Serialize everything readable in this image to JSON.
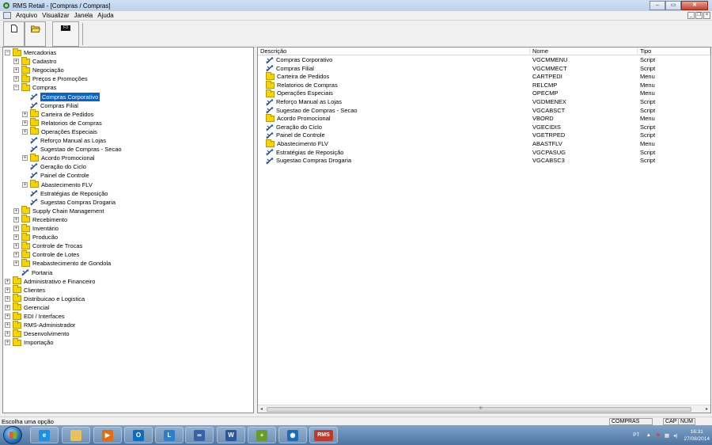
{
  "window": {
    "title": "RMS Retail - [Compras / Compras]",
    "buttons": [
      "",
      "",
      ""
    ]
  },
  "menubar": {
    "items": [
      "Arquivo",
      "Visualizar",
      "Janela",
      "Ajuda"
    ]
  },
  "toolbar": {
    "buttons": [
      {
        "icon": "new-document-icon"
      },
      {
        "icon": "open-folder-icon"
      },
      {
        "icon": "f3-key-icon",
        "label": "F3"
      }
    ]
  },
  "tree": {
    "items": [
      {
        "label": "Mercadorias",
        "level": 0,
        "expander": "-",
        "icon": "folder"
      },
      {
        "label": "Cadastro",
        "level": 1,
        "expander": "+",
        "icon": "folder"
      },
      {
        "label": "Negociação",
        "level": 1,
        "expander": "+",
        "icon": "folder"
      },
      {
        "label": "Preços e Promoções",
        "level": 1,
        "expander": "+",
        "icon": "folder"
      },
      {
        "label": "Compras",
        "level": 1,
        "expander": "-",
        "icon": "folder"
      },
      {
        "label": "Compras Corporativo",
        "level": 2,
        "expander": "",
        "icon": "script",
        "selected": true
      },
      {
        "label": "Compras Filial",
        "level": 2,
        "expander": "",
        "icon": "script"
      },
      {
        "label": "Carteira de Pedidos",
        "level": 2,
        "expander": "+",
        "icon": "folder"
      },
      {
        "label": "Relatorios de Compras",
        "level": 2,
        "expander": "+",
        "icon": "folder"
      },
      {
        "label": "Operações Especiais",
        "level": 2,
        "expander": "+",
        "icon": "folder"
      },
      {
        "label": "Reforço Manual as Lojas",
        "level": 2,
        "expander": "",
        "icon": "script"
      },
      {
        "label": "Sugestao de Compras - Secao",
        "level": 2,
        "expander": "",
        "icon": "script"
      },
      {
        "label": "Acordo Promocional",
        "level": 2,
        "expander": "+",
        "icon": "folder"
      },
      {
        "label": "Geração do Ciclo",
        "level": 2,
        "expander": "",
        "icon": "script"
      },
      {
        "label": "Painel de Controle",
        "level": 2,
        "expander": "",
        "icon": "script"
      },
      {
        "label": "Abastecimento FLV",
        "level": 2,
        "expander": "+",
        "icon": "folder"
      },
      {
        "label": "Estratégias de Reposição",
        "level": 2,
        "expander": "",
        "icon": "script"
      },
      {
        "label": "Sugestao Compras Drogaria",
        "level": 2,
        "expander": "",
        "icon": "script"
      },
      {
        "label": "Supply Chain Management",
        "level": 1,
        "expander": "+",
        "icon": "folder"
      },
      {
        "label": "Recebimento",
        "level": 1,
        "expander": "+",
        "icon": "folder"
      },
      {
        "label": "Inventário",
        "level": 1,
        "expander": "+",
        "icon": "folder"
      },
      {
        "label": "Producão",
        "level": 1,
        "expander": "+",
        "icon": "folder"
      },
      {
        "label": "Controle de Trocas",
        "level": 1,
        "expander": "+",
        "icon": "folder"
      },
      {
        "label": "Controle de Lotes",
        "level": 1,
        "expander": "+",
        "icon": "folder"
      },
      {
        "label": "Reabastecimento de Gondola",
        "level": 1,
        "expander": "+",
        "icon": "folder"
      },
      {
        "label": "Portaria",
        "level": 1,
        "expander": "",
        "icon": "script"
      },
      {
        "label": "Administrativo e Financeiro",
        "level": 0,
        "expander": "+",
        "icon": "folder"
      },
      {
        "label": "Clientes",
        "level": 0,
        "expander": "+",
        "icon": "folder"
      },
      {
        "label": "Distribuicao e Logistica",
        "level": 0,
        "expander": "+",
        "icon": "folder"
      },
      {
        "label": "Gerencial",
        "level": 0,
        "expander": "+",
        "icon": "folder"
      },
      {
        "label": "EDI / Interfaces",
        "level": 0,
        "expander": "+",
        "icon": "folder"
      },
      {
        "label": "RMS-Administrador",
        "level": 0,
        "expander": "+",
        "icon": "folder"
      },
      {
        "label": "Desenvolvimento",
        "level": 0,
        "expander": "+",
        "icon": "folder"
      },
      {
        "label": "Importação",
        "level": 0,
        "expander": "+",
        "icon": "folder"
      }
    ]
  },
  "list": {
    "columns": [
      "Descrição",
      "Nome",
      "Tipo"
    ],
    "rows": [
      {
        "icon": "script",
        "descricao": "Compras Corporativo",
        "nome": "VGCMMENU",
        "tipo": "Script"
      },
      {
        "icon": "script",
        "descricao": "Compras Filial",
        "nome": "VGCMMECT",
        "tipo": "Script"
      },
      {
        "icon": "folder",
        "descricao": "Carteira de Pedidos",
        "nome": "CARTPEDI",
        "tipo": "Menu"
      },
      {
        "icon": "folder",
        "descricao": "Relatorios de Compras",
        "nome": "RELCMP",
        "tipo": "Menu"
      },
      {
        "icon": "folder",
        "descricao": "Operações Especiais",
        "nome": "OPECMP",
        "tipo": "Menu"
      },
      {
        "icon": "script",
        "descricao": "Reforço Manual as Lojas",
        "nome": "VGDMENEX",
        "tipo": "Script"
      },
      {
        "icon": "script",
        "descricao": "Sugestao de Compras - Secao",
        "nome": "VGCABSCT",
        "tipo": "Script"
      },
      {
        "icon": "folder",
        "descricao": "Acordo Promocional",
        "nome": "VBORD",
        "tipo": "Menu"
      },
      {
        "icon": "script",
        "descricao": "Geração do Ciclo",
        "nome": "VGECIDIS",
        "tipo": "Script"
      },
      {
        "icon": "script",
        "descricao": "Painel de Controle",
        "nome": "VGETRPED",
        "tipo": "Script"
      },
      {
        "icon": "folder",
        "descricao": "Abastecimento FLV",
        "nome": "ABASTFLV",
        "tipo": "Menu"
      },
      {
        "icon": "script",
        "descricao": "Estratégias de Reposição",
        "nome": "VGCPASUG",
        "tipo": "Script"
      },
      {
        "icon": "script",
        "descricao": "Sugestao Compras Drogaria",
        "nome": "VGCABSC3",
        "tipo": "Script"
      }
    ],
    "scroll_glyph": "III"
  },
  "statusbar": {
    "message": "Escolha uma opção",
    "module": "COMPRAS",
    "caps": "CAP",
    "num": "NUM"
  },
  "taskbar": {
    "apps": [
      {
        "icon": "internet-explorer-icon",
        "glyph": "e",
        "color": "#1e90e0"
      },
      {
        "icon": "file-explorer-icon",
        "glyph": "",
        "color": "#e9c15a"
      },
      {
        "icon": "media-player-icon",
        "glyph": "▶",
        "color": "#e36b12"
      },
      {
        "icon": "outlook-icon",
        "glyph": "O",
        "color": "#0f6cbd"
      },
      {
        "icon": "lync-icon",
        "glyph": "L",
        "color": "#2a7fd0"
      },
      {
        "icon": "remote-desktop-icon",
        "glyph": "∞",
        "color": "#3b5fa8"
      },
      {
        "icon": "word-icon",
        "glyph": "W",
        "color": "#2b579a"
      },
      {
        "icon": "calculator-icon",
        "glyph": "+",
        "color": "#6a9a2c"
      },
      {
        "icon": "webex-icon",
        "glyph": "◉",
        "color": "#1c6bb8"
      },
      {
        "icon": "rms-icon",
        "glyph": "RMS",
        "color": "#c0392b"
      }
    ],
    "tray": {
      "lang": "PT",
      "time": "16:31",
      "date": "27/08/2014"
    }
  }
}
